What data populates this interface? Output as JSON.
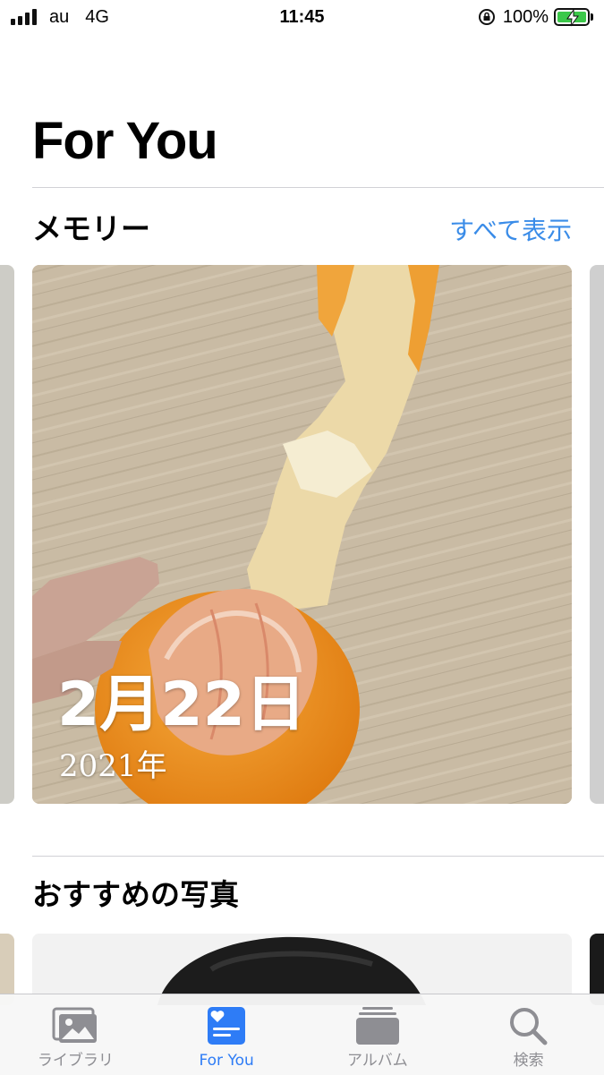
{
  "status_bar": {
    "carrier": "au",
    "network": "4G",
    "time": "11:45",
    "battery": "100%",
    "battery_level": 1.0,
    "battery_color": "#3cc84a"
  },
  "page_title": "For You",
  "memories": {
    "title": "メモリー",
    "see_all": "すべて表示",
    "card": {
      "date": "2月22日",
      "year": "2021年"
    }
  },
  "featured_photos": {
    "title": "おすすめの写真"
  },
  "tab_bar": {
    "accent_color": "#2e7cf6",
    "tabs": [
      {
        "label": "ライブラリ",
        "icon": "photos-library-icon"
      },
      {
        "label": "For You",
        "icon": "for-you-icon",
        "active": true
      },
      {
        "label": "アルバム",
        "icon": "albums-icon"
      },
      {
        "label": "検索",
        "icon": "search-icon"
      }
    ]
  }
}
